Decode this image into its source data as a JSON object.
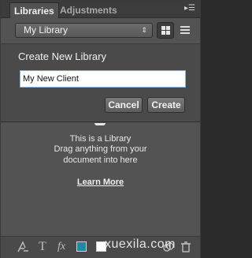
{
  "tabs": [
    {
      "label": "Libraries",
      "active": true
    },
    {
      "label": "Adjustments",
      "active": false
    }
  ],
  "panel_menu_icon": "panel-menu-icon",
  "library_select": {
    "value": "My Library",
    "arrows": "⇕"
  },
  "view_modes": [
    "grid-view-icon",
    "list-view-icon"
  ],
  "create_popup": {
    "title": "Create New Library",
    "name_value": "My New Client",
    "cancel_label": "Cancel",
    "create_label": "Create"
  },
  "empty_state": {
    "line1": "This is a Library",
    "line2": "Drag anything from your",
    "line3": "document into here",
    "learn_more": "Learn More"
  },
  "footer": {
    "text_glyph": "T",
    "fx_glyph": "fx",
    "color_swatch": "#1f8aa6",
    "icons": [
      "character-style-icon",
      "text-icon",
      "fx-icon",
      "color-swatch-icon",
      "white-swatch-icon",
      "creative-cloud-icon",
      "trash-icon"
    ]
  },
  "watermark": "xuexila.com"
}
